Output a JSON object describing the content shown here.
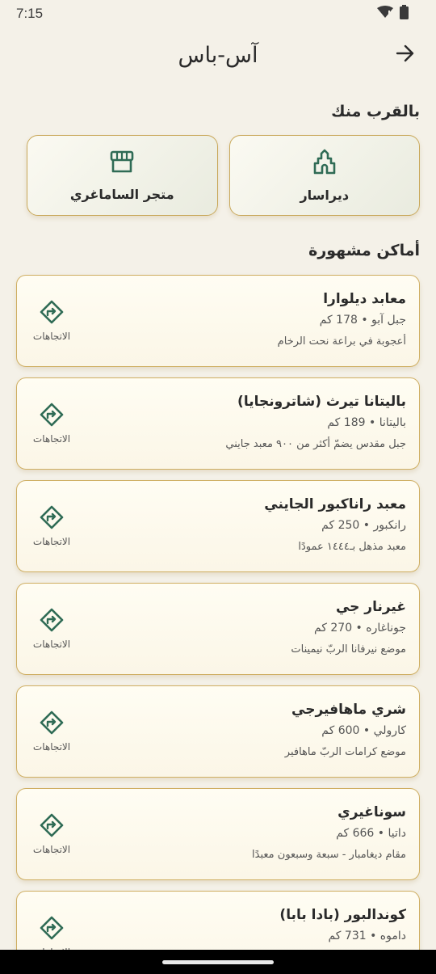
{
  "status": {
    "time": "7:15"
  },
  "app": {
    "title": "آس-باس"
  },
  "nearby": {
    "title": "بالقرب منك",
    "items": [
      {
        "label": "ديراسار",
        "icon": "temple-icon"
      },
      {
        "label": "متجر الساماغري",
        "icon": "store-icon"
      }
    ]
  },
  "famous": {
    "title": "أماكن مشهورة",
    "directions_label": "الاتجاهات",
    "places": [
      {
        "name": "معابد ديلوارا",
        "meta": "جبل آبو • 178 كم",
        "desc": "أعجوبة في براعة نحت الرخام"
      },
      {
        "name": "باليتانا تيرث (شاترونجايا)",
        "meta": "باليتانا • 189 كم",
        "desc": "جبل مقدس يضمّ أكثر من ٩٠٠ معبد جايني"
      },
      {
        "name": "معبد راناكبور الجايني",
        "meta": "رانكبور • 250 كم",
        "desc": "معبد مذهل بـ١٤٤٤ عمودًا"
      },
      {
        "name": "غيرنار جي",
        "meta": "جوناغاره • 270 كم",
        "desc": "موضع نيرفانا الربّ نيمينات"
      },
      {
        "name": "شري ماهافيرجي",
        "meta": "كارولي • 600 كم",
        "desc": "موضع كرامات الربّ ماهافير"
      },
      {
        "name": "سوناغيري",
        "meta": "داتيا • 666 كم",
        "desc": "مقام ديغامبار - سبعة وسبعون معبدًا"
      },
      {
        "name": "كوندالبور (بادا بابا)",
        "meta": "داموه • 731 كم",
        "desc": ""
      }
    ]
  },
  "colors": {
    "accent": "#2f6b55",
    "gold_border": "#c9a85a",
    "background": "#f4f1e8"
  }
}
